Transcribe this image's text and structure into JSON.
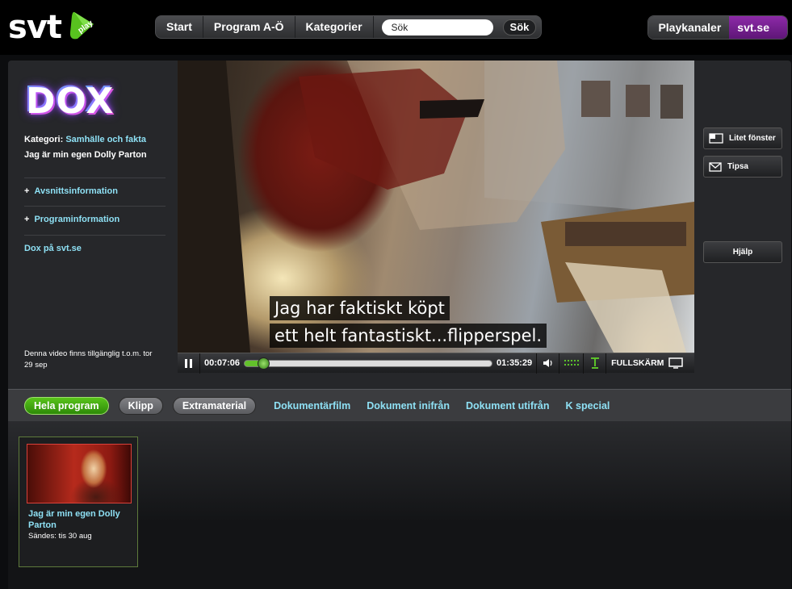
{
  "header": {
    "logo_text": "svt",
    "logo_badge": "play",
    "nav": [
      "Start",
      "Program A-Ö",
      "Kategorier"
    ],
    "search_value": "Sök",
    "search_button": "Sök",
    "right": {
      "channels": "Playkanaler",
      "svtse": "svt.se"
    }
  },
  "sidebar": {
    "show_logo": "DOX",
    "category_label": "Kategori:",
    "category_value": "Samhälle och fakta",
    "episode_title": "Jag är min egen Dolly Parton",
    "links": [
      "Avsnittsinformation",
      "Programinformation"
    ],
    "site_link": "Dox på svt.se",
    "availability": "Denna video finns tillgänglig t.o.m. tor 29 sep"
  },
  "player": {
    "subtitle_lines": [
      "Jag har faktiskt köpt",
      "ett helt fantastiskt...flipperspel."
    ],
    "time_current": "00:07:06",
    "time_total": "01:35:29",
    "progress_fraction": 0.074,
    "fullscreen_label": "FULLSKÄRM"
  },
  "right_buttons": {
    "small_window": "Litet fönster",
    "tip": "Tipsa",
    "help": "Hjälp"
  },
  "tabs": {
    "pills": [
      {
        "label": "Hela program",
        "active": true
      },
      {
        "label": "Klipp",
        "active": false
      },
      {
        "label": "Extramaterial",
        "active": false
      }
    ],
    "links": [
      "Dokumentärfilm",
      "Dokument inifrån",
      "Dokument utifrån",
      "K special"
    ]
  },
  "cards": [
    {
      "title": "Jag är min egen Dolly Parton",
      "date": "Sändes: tis 30 aug"
    }
  ],
  "colors": {
    "accent_link": "#8ee0f4",
    "active_green": "#59c41c",
    "svt_purple": "#8d2aa8"
  }
}
